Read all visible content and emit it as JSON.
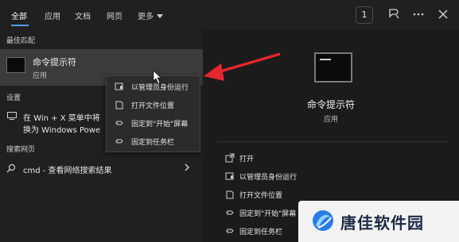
{
  "tabs": [
    {
      "label": "全部",
      "active": true
    },
    {
      "label": "应用"
    },
    {
      "label": "文档"
    },
    {
      "label": "网页"
    },
    {
      "label": "更多"
    }
  ],
  "topbar": {
    "count": "1"
  },
  "sections": {
    "best_match": "最佳匹配",
    "settings": "设置",
    "web_search": "搜索网页"
  },
  "best_match": {
    "title": "命令提示符",
    "subtitle": "应用"
  },
  "settings_item": {
    "line1": "在 Win + X 菜单中将",
    "line2": "换为 Windows Powe"
  },
  "web_item": {
    "text": "cmd - 查看网络搜索结果"
  },
  "context_menu": {
    "items": [
      {
        "label": "以管理员身份运行",
        "icon": "admin-shield-icon"
      },
      {
        "label": "打开文件位置",
        "icon": "folder-icon"
      },
      {
        "label": "固定到\"开始\"屏幕",
        "icon": "pin-icon"
      },
      {
        "label": "固定到任务栏",
        "icon": "pin-icon"
      }
    ]
  },
  "preview": {
    "title": "命令提示符",
    "subtitle": "应用",
    "actions": [
      {
        "label": "打开",
        "icon": "open-icon"
      },
      {
        "label": "以管理员身份运行",
        "icon": "admin-shield-icon"
      },
      {
        "label": "打开文件位置",
        "icon": "folder-icon"
      },
      {
        "label": "固定到\"开始\"屏幕",
        "icon": "pin-icon"
      },
      {
        "label": "固定到任务栏",
        "icon": "pin-icon"
      }
    ]
  },
  "watermark": {
    "text": "唐佳软件园"
  },
  "colors": {
    "accent": "#4ea1ff",
    "arrow": "#e5262e"
  }
}
